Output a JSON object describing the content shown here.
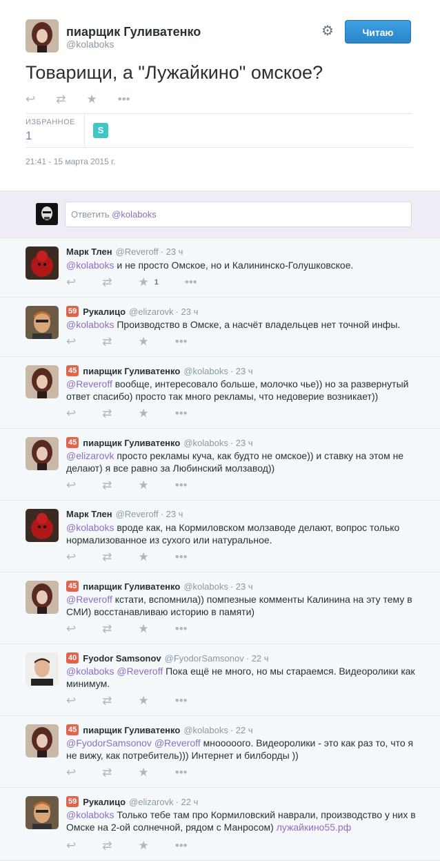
{
  "author": {
    "name": "пиарщик Гуливатенко",
    "handle": "@kolaboks"
  },
  "follow_label": "Читаю",
  "tweet": {
    "text": "Товарищи, а \"Лужайкино\" омское?",
    "favorites_label": "ИЗБРАННОЕ",
    "favorites_count": "1",
    "favoriter_avatar_glyph": "S",
    "timestamp": "21:41 - 15 марта 2015 г."
  },
  "reply_box": {
    "placeholder": "Ответить ",
    "mention": "@kolaboks"
  },
  "icons": {
    "reply": "reply-icon",
    "retweet": "retweet-icon",
    "favorite": "star-icon",
    "more": "more-icon",
    "settings": "gear-icon"
  },
  "colors": {
    "accent": "#8a6fc4",
    "badge": "#e0644c",
    "follow": "#2a85c9"
  },
  "replies": [
    {
      "badge": "",
      "name": "Марк Тлен",
      "handle": "@Reveroff",
      "time": "· 23 ч",
      "parts": [
        {
          "m": "@kolaboks"
        },
        {
          "t": " и не просто Омское, но и Калининско-Голушковское."
        }
      ],
      "fav": "1",
      "av": "red"
    },
    {
      "badge": "59",
      "name": "Рукалицо",
      "handle": "@elizarovk",
      "time": "· 23 ч",
      "parts": [
        {
          "m": "@kolaboks"
        },
        {
          "t": " Производство в Омске, а насчёт владельцев нет точной инфы."
        }
      ],
      "fav": "",
      "av": "man"
    },
    {
      "badge": "45",
      "name": "пиарщик Гуливатенко",
      "handle": "@kolaboks",
      "time": "· 23 ч",
      "parts": [
        {
          "m": "@Reveroff"
        },
        {
          "t": " вообще, интересовало больше, молочко чье)) но за развернутый ответ спасибо) просто так много рекламы, что недоверие возникает))"
        }
      ],
      "fav": "",
      "av": "woman"
    },
    {
      "badge": "45",
      "name": "пиарщик Гуливатенко",
      "handle": "@kolaboks",
      "time": "· 23 ч",
      "parts": [
        {
          "m": "@elizarovk"
        },
        {
          "t": " просто рекламы куча, как будто не омское)) и ставку на этом не делают) я все равно за Любинский молзавод))"
        }
      ],
      "fav": "",
      "av": "woman"
    },
    {
      "badge": "",
      "name": "Марк Тлен",
      "handle": "@Reveroff",
      "time": "· 23 ч",
      "parts": [
        {
          "m": "@kolaboks"
        },
        {
          "t": " вроде как, на Кормиловском молзаводе делают, вопрос только нормализованное из сухого или натуральное."
        }
      ],
      "fav": "",
      "av": "red"
    },
    {
      "badge": "45",
      "name": "пиарщик Гуливатенко",
      "handle": "@kolaboks",
      "time": "· 23 ч",
      "parts": [
        {
          "m": "@Reveroff"
        },
        {
          "t": " кстати, вспомнила)) помпезные комменты Калинина на эту тему в СМИ) восстанавливаю историю в памяти)"
        }
      ],
      "fav": "",
      "av": "woman"
    },
    {
      "badge": "40",
      "name": "Fyodor Samsonov",
      "handle": "@FyodorSamsonov",
      "time": "· 22 ч",
      "parts": [
        {
          "m": "@kolaboks"
        },
        {
          "t": " "
        },
        {
          "m": "@Reveroff"
        },
        {
          "t": " Пока ещё не много, но мы стараемся. Видеоролики как минимум."
        }
      ],
      "fav": "",
      "av": "fyodor"
    },
    {
      "badge": "45",
      "name": "пиарщик Гуливатенко",
      "handle": "@kolaboks",
      "time": "· 22 ч",
      "parts": [
        {
          "m": "@FyodorSamsonov"
        },
        {
          "t": " "
        },
        {
          "m": "@Reveroff"
        },
        {
          "t": " мнооооого. Видеоролики - это как раз то, что я не вижу, как потребитель))) Интернет и билборды ))"
        }
      ],
      "fav": "",
      "av": "woman"
    },
    {
      "badge": "59",
      "name": "Рукалицо",
      "handle": "@elizarovk",
      "time": "· 22 ч",
      "parts": [
        {
          "m": "@kolaboks"
        },
        {
          "t": " Только тебе там про Кормиловский наврали, производство у них в Омске на 2-ой солнечной, рядом с Манросом) "
        },
        {
          "m": "лужайкино55.рф"
        }
      ],
      "fav": "",
      "av": "man"
    }
  ]
}
